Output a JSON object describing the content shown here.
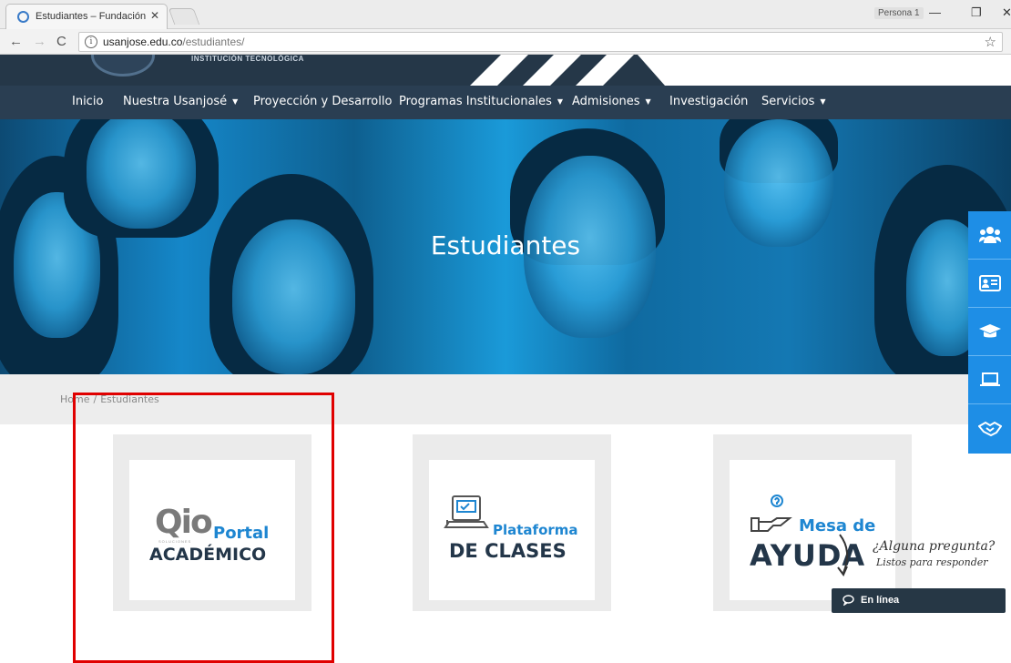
{
  "browser": {
    "tab_title": "Estudiantes – Fundación",
    "tab_close": "✕",
    "profile_label": "Persona 1",
    "window_min": "—",
    "window_max": "❐",
    "window_close": "✕",
    "url_host": "usanjose.edu.co",
    "url_path": "/estudiantes/",
    "info_glyph": "i",
    "star_glyph": "☆",
    "back_glyph": "←",
    "forward_glyph": "→",
    "reload_glyph": "C"
  },
  "header": {
    "logo_subtitle": "INSTITUCIÓN TECNOLÓGICA"
  },
  "nav": {
    "items": [
      {
        "label": "Inicio",
        "has_menu": false
      },
      {
        "label": "Nuestra Usanjosé",
        "has_menu": true
      },
      {
        "label": "Proyección y Desarrollo",
        "has_menu": false
      },
      {
        "label": "Programas Institucionales",
        "has_menu": true
      },
      {
        "label": "Admisiones",
        "has_menu": true
      },
      {
        "label": "Investigación",
        "has_menu": false
      },
      {
        "label": "Servicios",
        "has_menu": true
      }
    ],
    "caret": "▼"
  },
  "hero": {
    "title": "Estudiantes"
  },
  "breadcrumb": {
    "home": "Home",
    "separator": "/",
    "current": "Estudiantes"
  },
  "sidebar": {
    "icons": [
      "users-icon",
      "id-card-icon",
      "graduation-cap-icon",
      "laptop-icon",
      "handshake-icon"
    ]
  },
  "cards": [
    {
      "brand": "Qio",
      "brand_sub": "SOLUCIONES",
      "line1": "Portal",
      "line2": "ACADÉMICO"
    },
    {
      "line1": "Plataforma",
      "line2": "DE CLASES"
    },
    {
      "line1": "Mesa de",
      "line2": "AYUDA"
    }
  ],
  "chat": {
    "question": "¿Alguna pregunta?",
    "subtitle": "Listos para responder",
    "status": "En línea"
  },
  "colors": {
    "nav_bg": "#2a3e52",
    "accent_blue": "#1e86d1",
    "sidebar_blue": "#1e8ee6",
    "highlight_red": "#e00000"
  }
}
